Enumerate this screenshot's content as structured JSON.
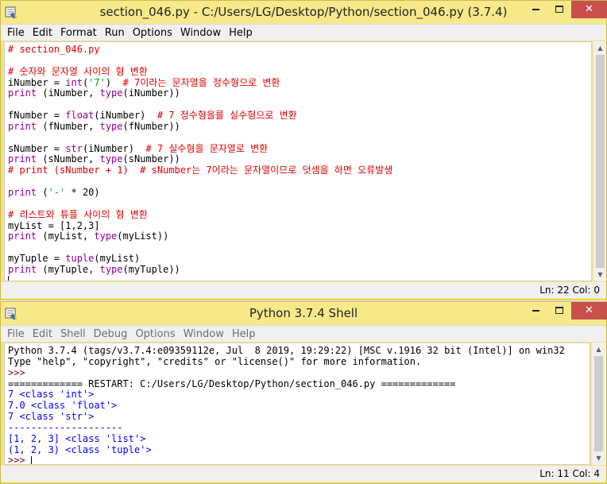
{
  "editor": {
    "title": "section_046.py - C:/Users/LG/Desktop/Python/section_046.py (3.7.4)",
    "menu": [
      "File",
      "Edit",
      "Format",
      "Run",
      "Options",
      "Window",
      "Help"
    ],
    "status": "Ln: 22  Col: 0",
    "code_lines": [
      [
        {
          "t": "# section_046.py",
          "c": "c-cmt"
        }
      ],
      [
        {
          "t": "",
          "c": "c-def"
        }
      ],
      [
        {
          "t": "# 숫자와 문자열 사이의 형 변환",
          "c": "c-cmt"
        }
      ],
      [
        {
          "t": "iNumber = ",
          "c": "c-def"
        },
        {
          "t": "int",
          "c": "c-bi"
        },
        {
          "t": "(",
          "c": "c-def"
        },
        {
          "t": "'7'",
          "c": "c-str"
        },
        {
          "t": ")  ",
          "c": "c-def"
        },
        {
          "t": "# 7이라는 문자열을 정수형으로 변환",
          "c": "c-cmt"
        }
      ],
      [
        {
          "t": "print",
          "c": "c-bi"
        },
        {
          "t": " (iNumber, ",
          "c": "c-def"
        },
        {
          "t": "type",
          "c": "c-bi"
        },
        {
          "t": "(iNumber))",
          "c": "c-def"
        }
      ],
      [
        {
          "t": "",
          "c": "c-def"
        }
      ],
      [
        {
          "t": "fNumber = ",
          "c": "c-def"
        },
        {
          "t": "float",
          "c": "c-bi"
        },
        {
          "t": "(iNumber)  ",
          "c": "c-def"
        },
        {
          "t": "# 7 정수형을를 실수형으로 변환",
          "c": "c-cmt"
        }
      ],
      [
        {
          "t": "print",
          "c": "c-bi"
        },
        {
          "t": " (fNumber, ",
          "c": "c-def"
        },
        {
          "t": "type",
          "c": "c-bi"
        },
        {
          "t": "(fNumber))",
          "c": "c-def"
        }
      ],
      [
        {
          "t": "",
          "c": "c-def"
        }
      ],
      [
        {
          "t": "sNumber = ",
          "c": "c-def"
        },
        {
          "t": "str",
          "c": "c-bi"
        },
        {
          "t": "(iNumber)  ",
          "c": "c-def"
        },
        {
          "t": "# 7 실수형을 문자열로 변환",
          "c": "c-cmt"
        }
      ],
      [
        {
          "t": "print",
          "c": "c-bi"
        },
        {
          "t": " (sNumber, ",
          "c": "c-def"
        },
        {
          "t": "type",
          "c": "c-bi"
        },
        {
          "t": "(sNumber))",
          "c": "c-def"
        }
      ],
      [
        {
          "t": "# print (sNumber + 1)  # sNumber는 7이라는 문자열이므로 덧셈을 하면 오류발생",
          "c": "c-cmt"
        }
      ],
      [
        {
          "t": "",
          "c": "c-def"
        }
      ],
      [
        {
          "t": "print",
          "c": "c-bi"
        },
        {
          "t": " (",
          "c": "c-def"
        },
        {
          "t": "'-'",
          "c": "c-str"
        },
        {
          "t": " * 20)",
          "c": "c-def"
        }
      ],
      [
        {
          "t": "",
          "c": "c-def"
        }
      ],
      [
        {
          "t": "# 리스트와 튜플 사이의 형 변환",
          "c": "c-cmt"
        }
      ],
      [
        {
          "t": "myList = [1,2,3]",
          "c": "c-def"
        }
      ],
      [
        {
          "t": "print",
          "c": "c-bi"
        },
        {
          "t": " (myList, ",
          "c": "c-def"
        },
        {
          "t": "type",
          "c": "c-bi"
        },
        {
          "t": "(myList))",
          "c": "c-def"
        }
      ],
      [
        {
          "t": "",
          "c": "c-def"
        }
      ],
      [
        {
          "t": "myTuple = ",
          "c": "c-def"
        },
        {
          "t": "tuple",
          "c": "c-bi"
        },
        {
          "t": "(myList)",
          "c": "c-def"
        }
      ],
      [
        {
          "t": "print",
          "c": "c-bi"
        },
        {
          "t": " (myTuple, ",
          "c": "c-def"
        },
        {
          "t": "type",
          "c": "c-bi"
        },
        {
          "t": "(myTuple))",
          "c": "c-def"
        }
      ]
    ]
  },
  "shell": {
    "title": "Python 3.7.4 Shell",
    "menu": [
      "File",
      "Edit",
      "Shell",
      "Debug",
      "Options",
      "Window",
      "Help"
    ],
    "status": "Ln: 11  Col: 4",
    "lines": [
      [
        {
          "t": "Python 3.7.4 (tags/v3.7.4:e09359112e, Jul  8 2019, 19:29:22) [MSC v.1916 32 bit (Intel)] on win32",
          "c": "c-def"
        }
      ],
      [
        {
          "t": "Type \"help\", \"copyright\", \"credits\" or \"license()\" for more information.",
          "c": "c-def"
        }
      ],
      [
        {
          "t": ">>> ",
          "c": "c-prompt"
        }
      ],
      [
        {
          "t": "============= RESTART: C:/Users/LG/Desktop/Python/section_046.py =============",
          "c": "c-def"
        }
      ],
      [
        {
          "t": "7 <class 'int'>",
          "c": "c-out"
        }
      ],
      [
        {
          "t": "7.0 <class 'float'>",
          "c": "c-out"
        }
      ],
      [
        {
          "t": "7 <class 'str'>",
          "c": "c-out"
        }
      ],
      [
        {
          "t": "--------------------",
          "c": "c-out"
        }
      ],
      [
        {
          "t": "[1, 2, 3] <class 'list'>",
          "c": "c-out"
        }
      ],
      [
        {
          "t": "(1, 2, 3) <class 'tuple'>",
          "c": "c-out"
        }
      ],
      [
        {
          "t": ">>> ",
          "c": "c-prompt"
        }
      ]
    ]
  },
  "icons": {
    "app": "idle-python-icon",
    "minimize": "minimize-icon",
    "maximize": "maximize-icon",
    "close": "close-icon"
  },
  "colors": {
    "titlebar": "#f7e98a",
    "comment": "#dd0000",
    "builtin": "#900090",
    "string": "#00aa00",
    "output": "#0000ff"
  }
}
